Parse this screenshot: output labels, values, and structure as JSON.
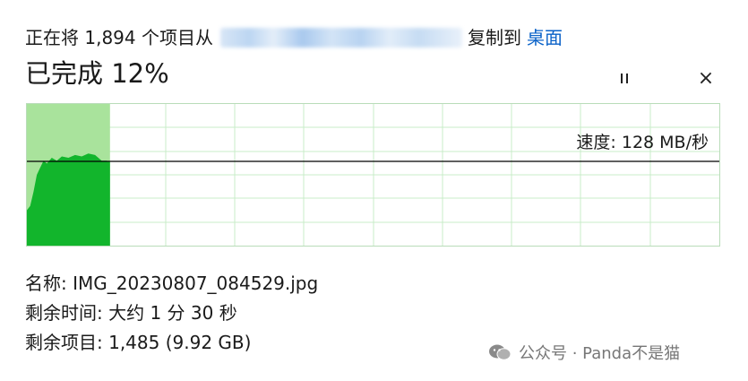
{
  "header": {
    "prefix": "正在将 1,894 个项目从",
    "copied_to": "复制到",
    "destination": "桌面"
  },
  "progress": {
    "title": "已完成 12%",
    "fraction": 0.12
  },
  "controls": {
    "close_symbol": "×"
  },
  "speed": {
    "label": "速度: 128 MB/秒"
  },
  "details": {
    "name": "名称: IMG_20230807_084529.jpg",
    "time_remaining": "剩余时间: 大约 1 分 30 秒",
    "items_remaining": "剩余项目: 1,485 (9.92 GB)"
  },
  "watermark": {
    "text": "公众号 · Panda不是猫"
  },
  "colors": {
    "fill_dark": "#12b52c",
    "fill_light": "#a9e39c",
    "grid": "#c8ecc8",
    "speed_line": "#000000",
    "link": "#0a62c8"
  }
}
